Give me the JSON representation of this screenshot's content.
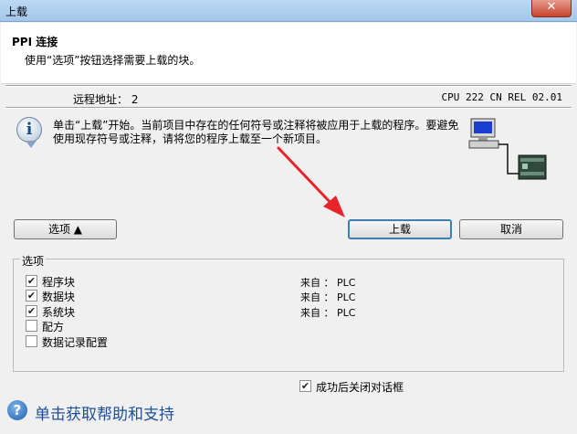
{
  "window": {
    "title": "上载",
    "close_label": "✕"
  },
  "header": {
    "title": "PPI 连接",
    "subtitle": "使用“选项”按钮选择需要上载的块。"
  },
  "connection": {
    "remote_address": "远程地址：  2",
    "cpu_info": "CPU 222 CN REL 02.01"
  },
  "message": "单击“上载”开始。当前项目中存在的任何符号或注释将被应用于上载的程序。要避免使用现存符号或注释，请将您的程序上载至一个新项目。",
  "buttons": {
    "options": "选项 ▲",
    "upload": "上载",
    "cancel": "取消"
  },
  "options_group": {
    "label": "选项",
    "items": [
      {
        "label": "程序块",
        "checked": true,
        "source": "来自 ： PLC"
      },
      {
        "label": "数据块",
        "checked": true,
        "source": "来自 ： PLC"
      },
      {
        "label": "系统块",
        "checked": true,
        "source": "来自 ： PLC"
      },
      {
        "label": "配方",
        "checked": false,
        "source": ""
      },
      {
        "label": "数据记录配置",
        "checked": false,
        "source": ""
      }
    ]
  },
  "close_after_success": {
    "label": "成功后关闭对话框",
    "checked": true
  },
  "help": {
    "label": "单击获取帮助和支持"
  },
  "icons": {
    "info": "info-icon",
    "help": "help-icon",
    "computer": "computer-plc-icon"
  },
  "colors": {
    "arrow": "#e8232a",
    "link": "#1d4f9c"
  }
}
